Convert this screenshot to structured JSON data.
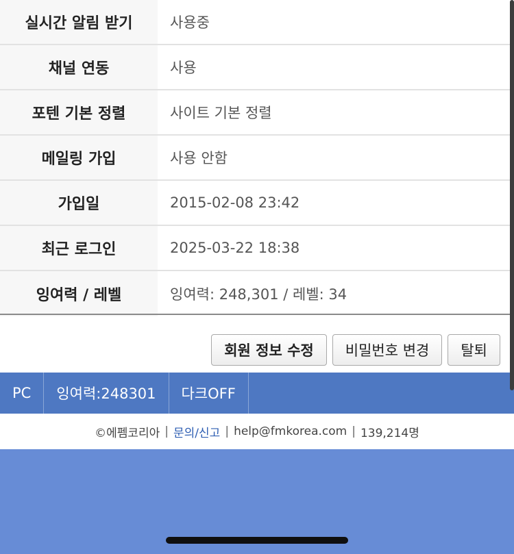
{
  "rows": [
    {
      "label": "실시간 알림 받기",
      "value": "사용중"
    },
    {
      "label": "채널 연동",
      "value": "사용"
    },
    {
      "label": "포텐 기본 정렬",
      "value": "사이트 기본 정렬"
    },
    {
      "label": "메일링 가입",
      "value": "사용 안함"
    },
    {
      "label": "가입일",
      "value": "2015-02-08 23:42"
    },
    {
      "label": "최근 로그인",
      "value": "2025-03-22 18:38"
    },
    {
      "label": "잉여력 / 레벨",
      "value": "잉여력: 248,301 / 레벨: 34"
    }
  ],
  "buttons": {
    "edit_profile": "회원 정보 수정",
    "change_password": "비밀번호 변경",
    "withdraw": "탈퇴"
  },
  "bottom_bar": {
    "pc": "PC",
    "points": "잉여력:248301",
    "dark_mode": "다크OFF"
  },
  "footer": {
    "copyright": "©에펨코리아",
    "contact": "문의/신고",
    "email": "help@fmkorea.com",
    "users": "139,214명",
    "separator": "|"
  },
  "colors": {
    "bar_blue": "#4e78c2",
    "area_blue": "#678cd6",
    "link_blue": "#2f5fb3"
  }
}
